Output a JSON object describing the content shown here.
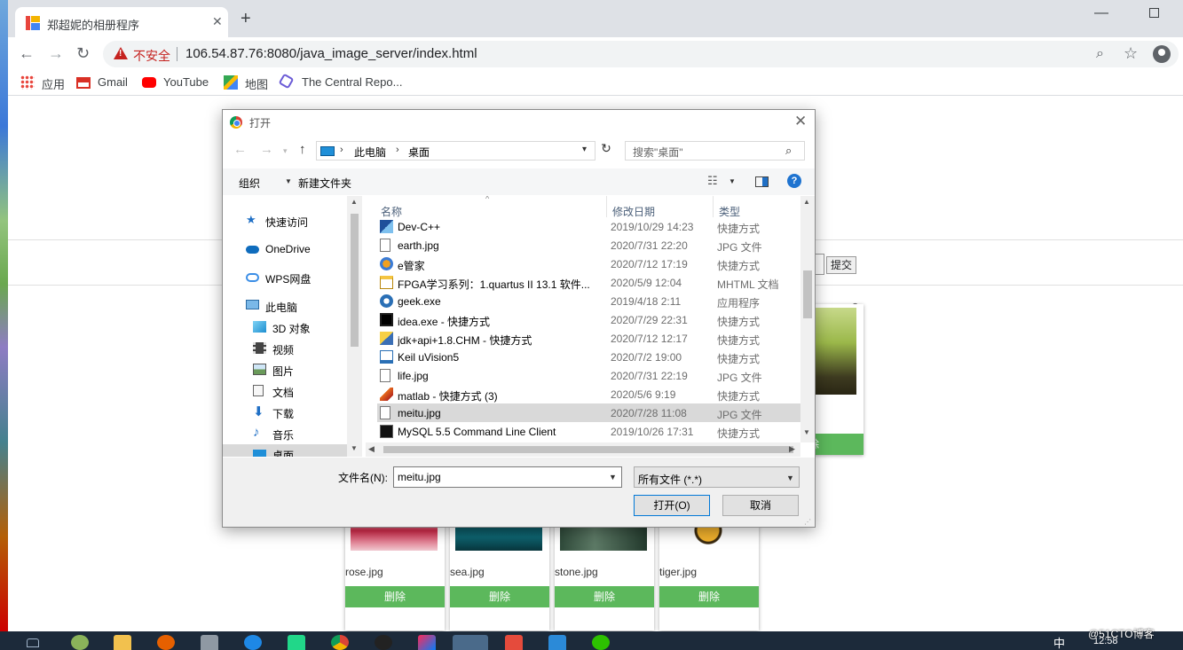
{
  "browser": {
    "tab_title": "郑超妮的相册程序",
    "not_secure": "不安全",
    "url": "106.54.87.76:8080/java_image_server/index.html",
    "bookmarks": [
      {
        "label": "应用",
        "icon": "apps-grid-icon"
      },
      {
        "label": "Gmail",
        "icon": "gmail-icon"
      },
      {
        "label": "YouTube",
        "icon": "youtube-icon"
      },
      {
        "label": "地图",
        "icon": "maps-icon"
      },
      {
        "label": "The Central Repo...",
        "icon": "central-repo-icon"
      }
    ]
  },
  "page": {
    "submit_label": "提交",
    "cards": [
      {
        "caption": "rose.jpg",
        "delete_label": "删除",
        "color": "#c81e3c"
      },
      {
        "caption": "sea.jpg",
        "delete_label": "删除",
        "color": "#0d5560"
      },
      {
        "caption": "stone.jpg",
        "delete_label": "删除",
        "color": "#3f5a4a"
      },
      {
        "caption": "tiger.jpg",
        "delete_label": "删除",
        "color": "#f1b12d"
      }
    ],
    "right_card_delete": "除"
  },
  "dialog": {
    "title": "打开",
    "address": {
      "pc": "此电脑",
      "desktop": "桌面"
    },
    "search_placeholder": "搜索\"桌面\"",
    "organize": "组织",
    "new_folder": "新建文件夹",
    "nav": [
      {
        "label": "快速访问",
        "icon": "star-icon",
        "indent": 0
      },
      {
        "label": "OneDrive",
        "icon": "cloud-icon",
        "indent": 0
      },
      {
        "label": "WPS网盘",
        "icon": "wps-cloud-icon",
        "indent": 0
      },
      {
        "label": "此电脑",
        "icon": "computer-icon",
        "indent": 0
      },
      {
        "label": "3D 对象",
        "icon": "cube-icon",
        "indent": 1
      },
      {
        "label": "视频",
        "icon": "video-icon",
        "indent": 1
      },
      {
        "label": "图片",
        "icon": "picture-icon",
        "indent": 1
      },
      {
        "label": "文档",
        "icon": "document-icon",
        "indent": 1
      },
      {
        "label": "下载",
        "icon": "download-icon",
        "indent": 1
      },
      {
        "label": "音乐",
        "icon": "music-icon",
        "indent": 1
      },
      {
        "label": "桌面",
        "icon": "desktop-icon",
        "indent": 1
      }
    ],
    "columns": {
      "name": "名称",
      "date": "修改日期",
      "type": "类型"
    },
    "files": [
      {
        "name": "Dev-C++",
        "date": "2019/10/29 14:23",
        "type": "快捷方式",
        "icon": "devcpp-icon"
      },
      {
        "name": "earth.jpg",
        "date": "2020/7/31 22:20",
        "type": "JPG 文件",
        "icon": "jpg-file-icon"
      },
      {
        "name": "e管家",
        "date": "2020/7/12 17:19",
        "type": "快捷方式",
        "icon": "e-manager-icon"
      },
      {
        "name": "FPGA学习系列：1.quartus II 13.1 软件...",
        "date": "2020/5/9 12:04",
        "type": "MHTML 文档",
        "icon": "mhtml-file-icon"
      },
      {
        "name": "geek.exe",
        "date": "2019/4/18 2:11",
        "type": "应用程序",
        "icon": "geek-exe-icon"
      },
      {
        "name": "idea.exe - 快捷方式",
        "date": "2020/7/29 22:31",
        "type": "快捷方式",
        "icon": "idea-icon"
      },
      {
        "name": "jdk+api+1.8.CHM - 快捷方式",
        "date": "2020/7/12 12:17",
        "type": "快捷方式",
        "icon": "chm-icon"
      },
      {
        "name": "Keil uVision5",
        "date": "2020/7/2 19:00",
        "type": "快捷方式",
        "icon": "keil-icon"
      },
      {
        "name": "life.jpg",
        "date": "2020/7/31 22:19",
        "type": "JPG 文件",
        "icon": "jpg-file-icon"
      },
      {
        "name": "matlab - 快捷方式 (3)",
        "date": "2020/5/6 9:19",
        "type": "快捷方式",
        "icon": "matlab-icon"
      },
      {
        "name": "meitu.jpg",
        "date": "2020/7/28 11:08",
        "type": "JPG 文件",
        "icon": "jpg-file-icon",
        "selected": true
      },
      {
        "name": "MySQL 5.5 Command Line Client",
        "date": "2019/10/26 17:31",
        "type": "快捷方式",
        "icon": "mysql-icon"
      }
    ],
    "filename_label": "文件名(N):",
    "filename_value": "meitu.jpg",
    "filter": "所有文件 (*.*)",
    "open_label": "打开(O)",
    "cancel_label": "取消"
  },
  "taskbar": {
    "lang": "中",
    "time": "12:58",
    "watermark": "@51CTO博客"
  }
}
